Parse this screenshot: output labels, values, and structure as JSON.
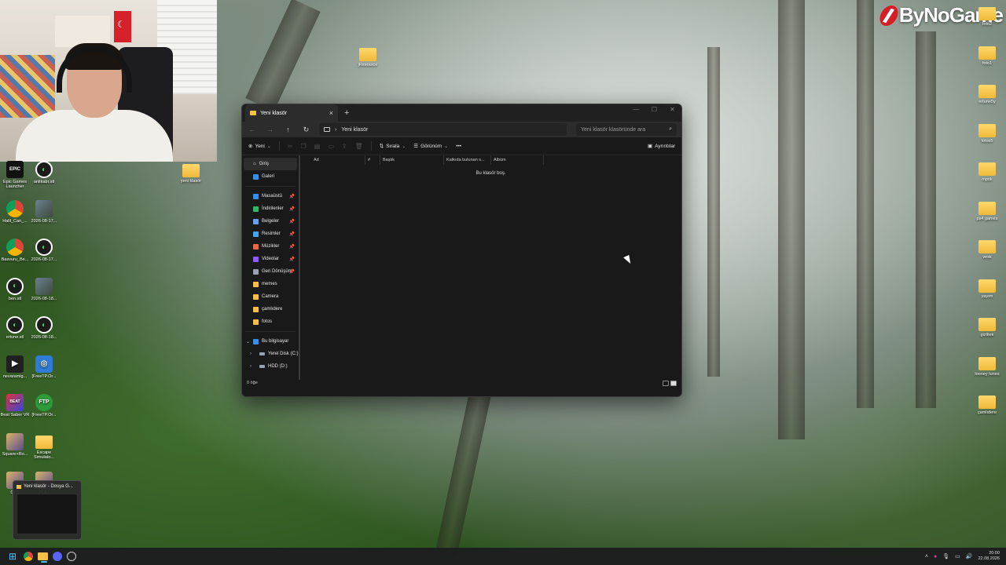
{
  "brand": {
    "logo_text": "ByNoGame"
  },
  "desktop": {
    "icons_left": [
      {
        "label": "Epic Games Launcher",
        "icon": "epic-icon"
      },
      {
        "label": "anitkabr.stl",
        "icon": "stl-file-icon"
      },
      {
        "label": "Halil_Can_...",
        "icon": "chrome-icon"
      },
      {
        "label": "2026-08-17...",
        "icon": "photo-icon"
      },
      {
        "label": "Basvuru_Be...",
        "icon": "chrome-icon"
      },
      {
        "label": "2026-08-17...",
        "icon": "stl-file-icon"
      },
      {
        "label": "ben.stl",
        "icon": "stl-file-icon"
      },
      {
        "label": "2026-08-18...",
        "icon": "photo-icon"
      },
      {
        "label": "ertune.stl",
        "icon": "stl-file-icon"
      },
      {
        "label": "2026-08-18...",
        "icon": "stl-file-icon"
      },
      {
        "label": "nevaramig...",
        "icon": "video-icon"
      },
      {
        "label": "[FreeTP.Or...",
        "icon": "zip-icon"
      },
      {
        "label": "Beat Saber VR",
        "icon": "beat-saber-icon"
      },
      {
        "label": "[FreeTP.Or...",
        "icon": "ftp-icon"
      },
      {
        "label": "Square+Ro...",
        "icon": "game-icon"
      },
      {
        "label": "Escape Simulato...",
        "icon": "folder-icon"
      },
      {
        "label": "CUT",
        "icon": "game-icon"
      },
      {
        "label": "PLA+",
        "icon": "game-icon"
      }
    ],
    "icon_mid_top": "jResource",
    "icon_mid": "yeni klasör",
    "icons_right": [
      {
        "label": "foto2",
        "icon": "folder-icon"
      },
      {
        "label": "foto1",
        "icon": "folder-icon"
      },
      {
        "label": "ertune5y",
        "icon": "folder-icon"
      },
      {
        "label": "fotos5",
        "icon": "folder-icon"
      },
      {
        "label": "mpolı",
        "icon": "folder-icon"
      },
      {
        "label": "ps4 games",
        "icon": "folder-icon"
      },
      {
        "label": "vesk",
        "icon": "folder-icon"
      },
      {
        "label": "yayım",
        "icon": "folder-icon"
      },
      {
        "label": "gizlitek",
        "icon": "folder-icon"
      },
      {
        "label": "looney tunes",
        "icon": "folder-icon"
      },
      {
        "label": "çamlıdere",
        "icon": "folder-icon"
      }
    ]
  },
  "explorer": {
    "tab_title": "Yeni klasör",
    "address": "Yeni klasör",
    "search_placeholder": "Yeni klasör klasöründe ara",
    "toolbar": {
      "new_label": "Yeni",
      "sort_label": "Sırala",
      "view_label": "Görünüm",
      "more_label": "•••",
      "details_label": "Ayrıntılar"
    },
    "nav": {
      "home": "Giriş",
      "gallery": "Galeri",
      "pinned": [
        {
          "label": "Masaüstü",
          "color": "#3a8ee6"
        },
        {
          "label": "İndirilenler",
          "color": "#39b36a"
        },
        {
          "label": "Belgeler",
          "color": "#6a9fe8"
        },
        {
          "label": "Resimler",
          "color": "#4aa3e6"
        },
        {
          "label": "Müzikler",
          "color": "#e06a4a"
        },
        {
          "label": "Videolar",
          "color": "#8b5cf6"
        },
        {
          "label": "Geri Dönüşüm",
          "color": "#9aa3ad"
        }
      ],
      "folders": [
        "memes",
        "Camera",
        "çamlıdere",
        "fotos"
      ],
      "this_pc": "Bu bilgisayar",
      "drives": [
        "Yerel Disk (C:)",
        "HDD (D:)"
      ]
    },
    "columns": [
      "Ad",
      "#",
      "Başlık",
      "Katkıda bulunan s...",
      "Albüm"
    ],
    "empty_message": "Bu klasör boş.",
    "status": "0 öğe"
  },
  "taskbar": {
    "thumbnail_title": "Yeni klasör - Dosya G...",
    "time": "20:00",
    "date": "22.08.2026"
  }
}
